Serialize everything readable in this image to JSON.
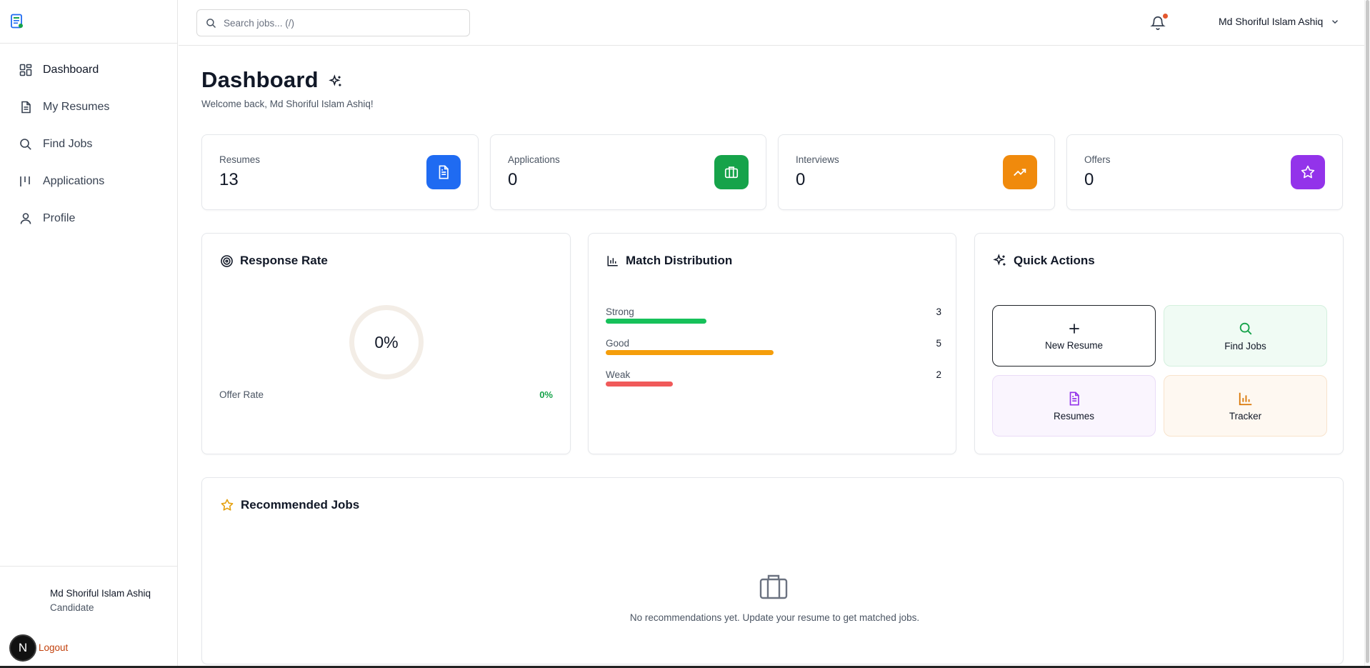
{
  "search": {
    "placeholder": "Search jobs... (/)"
  },
  "header": {
    "user_name": "Md Shoriful Islam Ashiq"
  },
  "sidebar": {
    "items": [
      {
        "label": "Dashboard",
        "icon": "grid-icon"
      },
      {
        "label": "My Resumes",
        "icon": "document-icon"
      },
      {
        "label": "Find Jobs",
        "icon": "search-icon"
      },
      {
        "label": "Applications",
        "icon": "columns-icon"
      },
      {
        "label": "Profile",
        "icon": "user-icon"
      }
    ],
    "user": {
      "name": "Md Shoriful Islam Ashiq",
      "role": "Candidate"
    },
    "logout_label": "Logout",
    "badge_letter": "N"
  },
  "page": {
    "title": "Dashboard",
    "subtitle": "Welcome back, Md Shoriful Islam Ashiq!"
  },
  "stats": [
    {
      "label": "Resumes",
      "value": "13",
      "color": "#1f6bf2",
      "icon": "document-icon"
    },
    {
      "label": "Applications",
      "value": "0",
      "color": "#16a34a",
      "icon": "briefcase-icon"
    },
    {
      "label": "Interviews",
      "value": "0",
      "color": "#f08a0c",
      "icon": "trending-up-icon"
    },
    {
      "label": "Offers",
      "value": "0",
      "color": "#9333ea",
      "icon": "star-icon"
    }
  ],
  "response_rate": {
    "title": "Response Rate",
    "value": "0%",
    "offer_rate_label": "Offer Rate",
    "offer_rate_value": "0%"
  },
  "match_distribution": {
    "title": "Match Distribution",
    "rows": [
      {
        "label": "Strong",
        "value": "3",
        "fraction": 0.3,
        "color": "#16c15a"
      },
      {
        "label": "Good",
        "value": "5",
        "fraction": 0.5,
        "color": "#f59e0b"
      },
      {
        "label": "Weak",
        "value": "2",
        "fraction": 0.2,
        "color": "#f05a5a"
      }
    ]
  },
  "quick_actions": {
    "title": "Quick Actions",
    "items": [
      {
        "label": "New Resume",
        "icon": "plus-icon"
      },
      {
        "label": "Find Jobs",
        "icon": "search-icon"
      },
      {
        "label": "Resumes",
        "icon": "document-icon"
      },
      {
        "label": "Tracker",
        "icon": "bar-chart-icon"
      }
    ]
  },
  "recommended": {
    "title": "Recommended Jobs",
    "empty_text": "No recommendations yet. Update your resume to get matched jobs."
  }
}
